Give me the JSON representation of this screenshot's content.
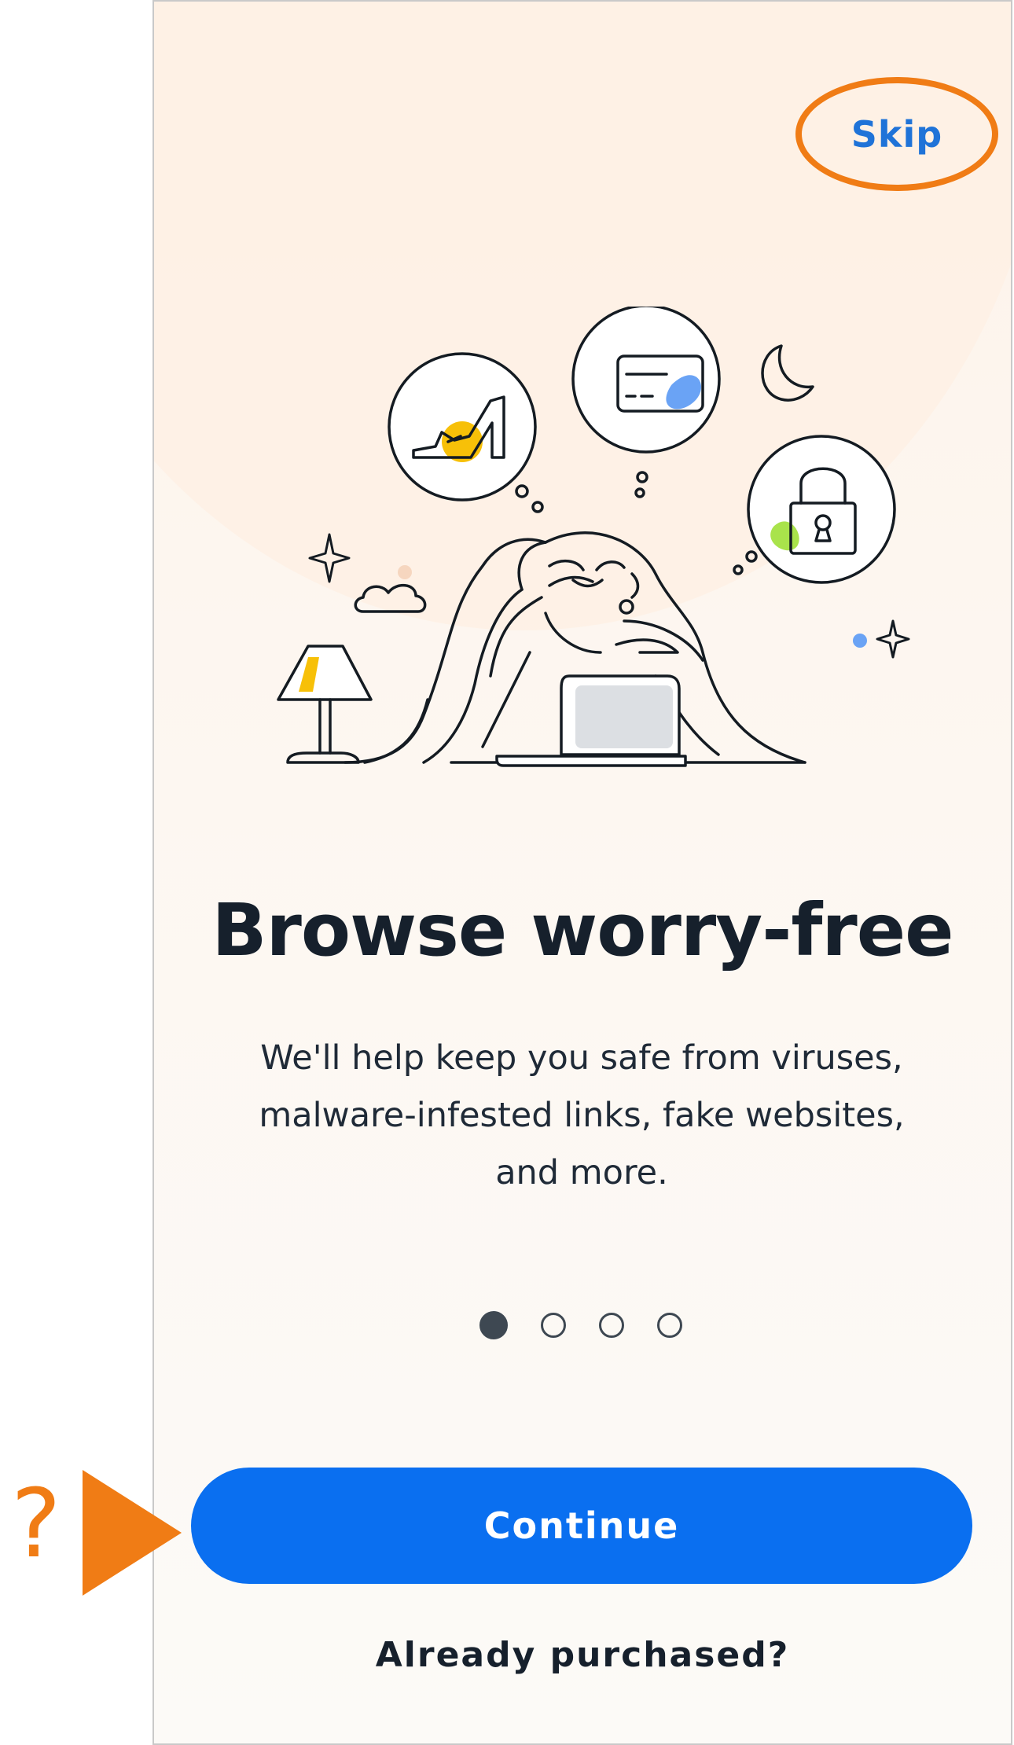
{
  "header": {
    "skip_label": "Skip"
  },
  "onboarding": {
    "title": "Browse worry-free",
    "description": "We'll help keep you safe from viruses, malware-infested links, fake websites, and more.",
    "pager": {
      "total": 4,
      "active_index": 0
    }
  },
  "actions": {
    "continue_label": "Continue",
    "already_purchased_label": "Already purchased?"
  },
  "annotation": {
    "question_mark": "?"
  },
  "colors": {
    "primary": "#0a6ff0",
    "link": "#1f73d8",
    "highlight": "#f07c15",
    "text_dark": "#16202c",
    "illustration_yellow": "#f7c008",
    "illustration_blue": "#6aa3f5",
    "illustration_green": "#a9e34b",
    "illustration_gray": "#dcdfe3"
  },
  "icons": [
    "high-heel-shoe-icon",
    "credit-card-icon",
    "padlock-icon",
    "moon-icon",
    "sparkle-icon",
    "cloud-icon",
    "lamp-icon",
    "laptop-icon"
  ]
}
